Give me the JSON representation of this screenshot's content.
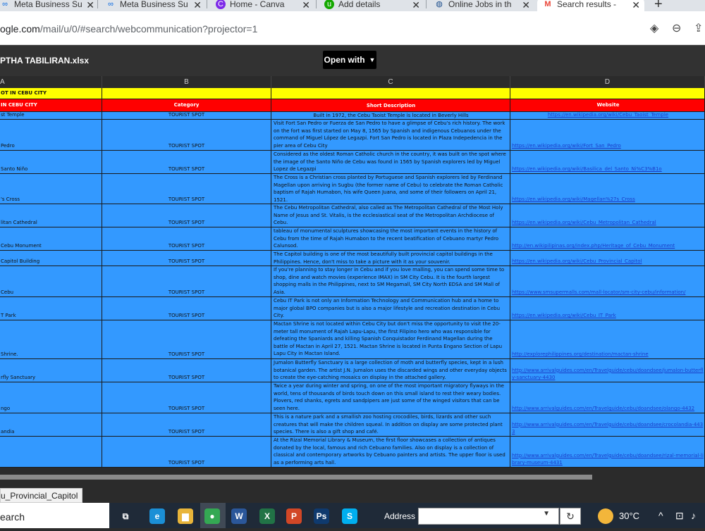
{
  "browser": {
    "tabs": [
      {
        "label": "Meta Business Su",
        "icon": "meta-icon"
      },
      {
        "label": "Meta Business Su",
        "icon": "meta-icon"
      },
      {
        "label": "Home - Canva",
        "icon": "canva-icon"
      },
      {
        "label": "Add details",
        "icon": "upwork-icon"
      },
      {
        "label": "Online Jobs in th",
        "icon": "globe-icon"
      },
      {
        "label": "Search results -",
        "icon": "gmail-icon"
      }
    ],
    "new_tab": "+",
    "url_domain": "ogle.com",
    "url_path": "/mail/u/0/#search/webcommunication?projector=1"
  },
  "viewer": {
    "filename": "PTHA TABILIRAN.xlsx",
    "open_with": "Open with"
  },
  "sheet": {
    "columns": [
      "A",
      "B",
      "C",
      "D"
    ],
    "title_row": "OT IN CEBU CITY",
    "header_row": {
      "a": "IN CEBU CITY",
      "b": "Category",
      "c": "Short Description",
      "d": "Website"
    },
    "rows": [
      {
        "a": "st Temple",
        "b": "TOURIST SPOT",
        "c": "Built in 1972, the Cebu Taoist Temple is located in Beverly Hills",
        "d": "https://en.wikipedia.org/wiki/Cebu_Taoist_Temple"
      },
      {
        "a": "Pedro",
        "b": "TOURIST SPOT",
        "c": "Visit Fort San Pedro or Fuerza de San Pedro to have a glimpse of Cebu's rich history. The work on the fort was first started on May 8, 1565 by Spanish and indigenous Cebuanos under the command of Miguel López de Legazpi. Fort San Pedro is located in Plaza Indepedencia in the pier area of Cebu City",
        "d": "https://en.wikipedia.org/wiki/Fort_San_Pedro"
      },
      {
        "a": "Santo Niño",
        "b": "TOURIST SPOT",
        "c": "Considered as the oldest Roman Catholic church in the country, it was built on the spot where the image of the Santo Niño de Cebu was found in 1565 by Spanish explorers led by Miguel Lopez de Legazpi",
        "d": "https://en.wikipedia.org/wiki/Basilica_del_Santo_Ni%C3%B1o"
      },
      {
        "a": "'s Cross",
        "b": "TOURIST SPOT",
        "c": "The Cross is a Christian cross planted by Portuguese and Spanish explorers led by Ferdinand Magellan upon arriving in Sugbu (the former name of Cebu) to celebrate the Roman Catholic baptism of Rajah Humabon, his wife Queen Juana, and some of their followers on April 21, 1521.",
        "d": "https://en.wikipedia.org/wiki/Magellan%27s_Cross"
      },
      {
        "a": "litan Cathedral",
        "b": "TOURIST SPOT",
        "c": "The Cebu Metropolitan Cathedral, also called as The Metropolitan Cathedral of the Most Holy Name of Jesus and St. Vitalis, is the ecclesiastical seat of the Metropolitan Archdiocese of Cebu.",
        "d": "https://en.wikipedia.org/wiki/Cebu_Metropolitan_Cathedral"
      },
      {
        "a": "Cebu Monument",
        "b": "TOURIST SPOT",
        "c": "tableau of monumental sculptures showcasing the most important events in the history of Cebu from the time of Rajah Humabon to the recent beatification of Cebuano martyr Pedro Calunsod.",
        "d": "http://en.wikipilipinas.org/index.php/Heritage_of_Cebu_Monument"
      },
      {
        "a": "Capitol Building",
        "b": "TOURIST SPOT",
        "c": "The Capitol building is one of the most beautifully built provincial capitol buildings in the Philippines. Hence, don't miss to take a picture with it as your souvenir.",
        "d": "https://en.wikipedia.org/wiki/Cebu_Provincial_Capitol"
      },
      {
        "a": "Cebu",
        "b": "TOURIST SPOT",
        "c": "If you're planning to stay longer in Cebu and if you love malling, you can spend some time to shop, dine and watch movies (experience IMAX) in SM City Cebu. It is the fourth largest shopping malls in the Philippines, next to SM Megamall, SM City North EDSA and SM Mall of Asia.",
        "d": "https://www.smsupermalls.com/mall-locator/sm-city-cebu/information/"
      },
      {
        "a": "T Park",
        "b": "TOURIST SPOT",
        "c": "Cebu IT Park is not only an Information Technology and Communication hub and a home to major global BPO companies but is also a major lifestyle and recreation destination in Cebu City.",
        "d": "https://en.wikipedia.org/wiki/Cebu_IT_Park"
      },
      {
        "a": "Shrine.",
        "b": "TOURIST SPOT",
        "c": "Mactan Shrine is not located within Cebu City but don't miss the opportunity to visit the 20-meter tall monument of Rajah Lapu-Lapu, the first Filipino hero who was responsible for defeating the Spaniards and killing Spanish Conquistador Ferdinand Magellan during the battle of Mactan in April 27, 1521. Mactan Shrine is located in Punta Engano Section of Lapu Lapu City in Mactan Island.",
        "d": "http://explorephilippines.org/destination/mactan-shrine"
      },
      {
        "a": "rfly Sanctuary",
        "b": "TOURIST SPOT",
        "c": "Jumalon Butterfly Sanctuary is a large collection of moth and butterfly species, kept in a lush botanical garden. The artist J.N. Jumalon uses the discarded wings and other everyday objects to create the eye-catching mosaics on display in the attached gallery.",
        "d": "http://www.arrivalguides.com/en/Travelguide/cebu/doandsee/jumalon-butterfly-sanctuary-4430"
      },
      {
        "a": "ngo",
        "b": "TOURIST SPOT",
        "c": "Twice a year during winter and spring, on one of the most important migratory flyways in the world, tens of thousands of birds touch down on this small island to rest their weary bodies. Plovers, red shanks, egrets and sandpipers are just some of the winged visitors that can be seen here.",
        "d": "http://www.arrivalguides.com/en/Travelguide/cebu/doandsee/olango-4432"
      },
      {
        "a": "andia",
        "b": "TOURIST SPOT",
        "c": "This is a nature park and a smallish zoo hosting crocodiles, birds, lizards and other such creatures that will make the children squeal. In addition on display are some protected plant species. There is also a gift shop and café.",
        "d": "http://www.arrivalguides.com/en/Travelguide/cebu/doandsee/crocolandia-4433"
      },
      {
        "a": "",
        "b": "TOURIST SPOT",
        "c": "At the Rizal Memorial Library & Museum, the first floor showcases a collection of antiques donated by the local, famous and rich Cebuano families. Also on display is a collection of classical and contemporary artworks by Cebuano painters and artists. The upper floor is used as a performing arts hall.",
        "d": "http://www.arrivalguides.com/en/Travelguide/cebu/doandsee/rizal-memorial-library-museum-4431"
      }
    ]
  },
  "status_tooltip": "u_Provincial_Capitol",
  "taskbar": {
    "search": "earch",
    "address_label": "Address",
    "temperature": "30°C",
    "apps": [
      {
        "icon": "task-view-icon",
        "label": "⧉",
        "color": "transparent"
      },
      {
        "icon": "edge-icon",
        "label": "e",
        "color": "#1b8fd6"
      },
      {
        "icon": "file-explorer-icon",
        "label": "▆",
        "color": "#e8b53a"
      },
      {
        "icon": "chrome-icon",
        "label": "●",
        "color": "#34a853"
      },
      {
        "icon": "word-icon",
        "label": "W",
        "color": "#2b579a"
      },
      {
        "icon": "excel-icon",
        "label": "X",
        "color": "#217346"
      },
      {
        "icon": "powerpoint-icon",
        "label": "P",
        "color": "#d24726"
      },
      {
        "icon": "photoshop-icon",
        "label": "Ps",
        "color": "#0f3a6e"
      },
      {
        "icon": "skype-icon",
        "label": "S",
        "color": "#00aff0"
      }
    ]
  }
}
